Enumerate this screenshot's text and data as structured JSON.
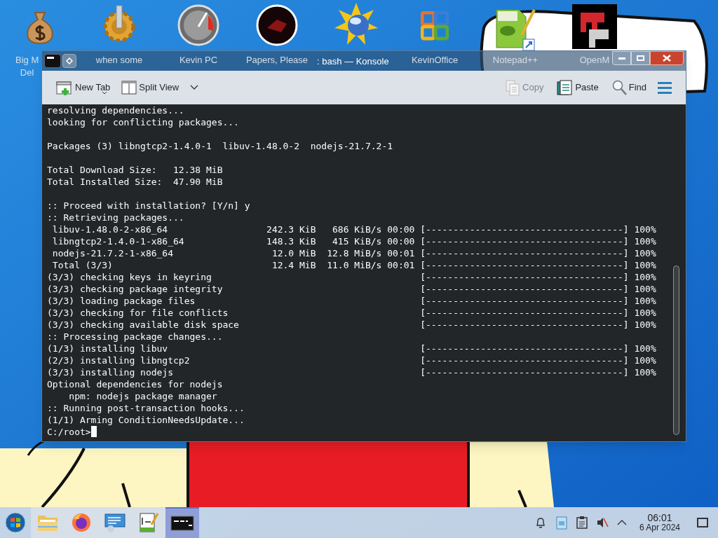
{
  "desktop_icons": [
    {
      "kind": "money-bag",
      "label": [
        "Big M",
        "Del"
      ]
    },
    {
      "kind": "gear",
      "label": [
        "when some"
      ]
    },
    {
      "kind": "gauge",
      "label": [
        "Kevin PC"
      ]
    },
    {
      "kind": "disc",
      "label": [
        "Papers, Please"
      ]
    },
    {
      "kind": "sun"
    },
    {
      "kind": "squares",
      "label": [
        "KevinOffice"
      ]
    },
    {
      "kind": "notepad",
      "label": [
        "Notepad++"
      ]
    },
    {
      "kind": "logo",
      "label": [
        "OpenM"
      ]
    }
  ],
  "window": {
    "title": ": bash — Konsole",
    "toolbar": [
      {
        "label": "New Tab",
        "disabled": false
      },
      {
        "label": "Split View",
        "disabled": false
      },
      {
        "label": "Copy",
        "disabled": true
      },
      {
        "label": "Paste",
        "disabled": false
      },
      {
        "label": "Find",
        "disabled": false
      }
    ],
    "terminal": [
      {
        "kind": "text",
        "text": "resolving dependencies..."
      },
      {
        "kind": "text",
        "text": "looking for conflicting packages..."
      },
      {
        "kind": "blank"
      },
      {
        "kind": "text",
        "text": "Packages (3) libngtcp2-1.4.0-1  libuv-1.48.0-2  nodejs-21.7.2-1"
      },
      {
        "kind": "blank"
      },
      {
        "kind": "text",
        "text": "Total Download Size:   12.38 MiB"
      },
      {
        "kind": "text",
        "text": "Total Installed Size:  47.90 MiB"
      },
      {
        "kind": "blank"
      },
      {
        "kind": "text",
        "text": ":: Proceed with installation? [Y/n] y"
      },
      {
        "kind": "text",
        "text": ":: Retrieving packages..."
      },
      {
        "kind": "progress",
        "text": " libuv-1.48.0-2-x86_64                  242.3 KiB   686 KiB/s 00:00",
        "bar": "[------------------------------------] 100%"
      },
      {
        "kind": "progress",
        "text": " libngtcp2-1.4.0-1-x86_64               148.3 KiB   415 KiB/s 00:00",
        "bar": "[------------------------------------] 100%"
      },
      {
        "kind": "progress",
        "text": " nodejs-21.7.2-1-x86_64                  12.0 MiB  12.8 MiB/s 00:01",
        "bar": "[------------------------------------] 100%"
      },
      {
        "kind": "progress",
        "text": " Total (3/3)                             12.4 MiB  11.0 MiB/s 00:01",
        "bar": "[------------------------------------] 100%"
      },
      {
        "kind": "progress",
        "text": "(3/3) checking keys in keyring",
        "bar": "[------------------------------------] 100%"
      },
      {
        "kind": "progress",
        "text": "(3/3) checking package integrity",
        "bar": "[------------------------------------] 100%"
      },
      {
        "kind": "progress",
        "text": "(3/3) loading package files",
        "bar": "[------------------------------------] 100%"
      },
      {
        "kind": "progress",
        "text": "(3/3) checking for file conflicts",
        "bar": "[------------------------------------] 100%"
      },
      {
        "kind": "progress",
        "text": "(3/3) checking available disk space",
        "bar": "[------------------------------------] 100%"
      },
      {
        "kind": "text",
        "text": ":: Processing package changes..."
      },
      {
        "kind": "progress",
        "text": "(1/3) installing libuv",
        "bar": "[------------------------------------] 100%"
      },
      {
        "kind": "progress",
        "text": "(2/3) installing libngtcp2",
        "bar": "[------------------------------------] 100%"
      },
      {
        "kind": "progress",
        "text": "(3/3) installing nodejs",
        "bar": "[------------------------------------] 100%"
      },
      {
        "kind": "text",
        "text": "Optional dependencies for nodejs"
      },
      {
        "kind": "text",
        "text": "    npm: nodejs package manager"
      },
      {
        "kind": "text",
        "text": ":: Running post-transaction hooks..."
      },
      {
        "kind": "text",
        "text": "(1/1) Arming ConditionNeedsUpdate..."
      },
      {
        "kind": "prompt",
        "text": "C:/root>"
      }
    ]
  },
  "taskbar": {
    "apps": [
      {
        "selected": false
      },
      {
        "selected": false
      },
      {
        "selected": false
      },
      {
        "selected": false
      },
      {
        "selected": true
      }
    ],
    "clock": {
      "time": "06:01",
      "date": "6 Apr 2024"
    }
  }
}
